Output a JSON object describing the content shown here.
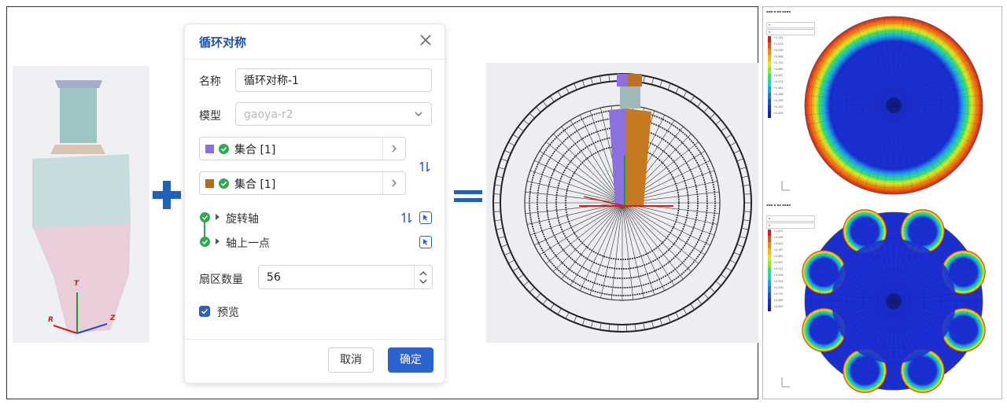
{
  "dialog": {
    "title": "循环对称",
    "name_label": "名称",
    "name_value": "循环对称-1",
    "model_label": "模型",
    "model_value": "gaoya-r2",
    "set1_label": "集合 [1]",
    "set1_color": "#8a6fe0",
    "set2_label": "集合 [1]",
    "set2_color": "#b56a1a",
    "axis_label": "旋转轴",
    "point_label": "轴上一点",
    "sectors_label": "扇区数量",
    "sectors_value": "56",
    "preview_label": "预览",
    "preview_checked": true,
    "cancel_label": "取消",
    "ok_label": "确定"
  },
  "model_axes": {
    "t": "T",
    "r": "R",
    "z": "Z"
  },
  "colors": {
    "accent": "#2a62d0",
    "operator": "#1f62b8",
    "ok_green": "#2fa84f"
  },
  "results": [
    {
      "pattern": "ring",
      "legend": [
        "+1.131",
        "+1.033",
        "+0.939",
        "+0.846",
        "+0.753",
        "+0.660",
        "+0.567",
        "+0.474",
        "+0.381",
        "+0.288",
        "+0.195",
        "+0.102",
        "+0.009"
      ]
    },
    {
      "pattern": "lobes",
      "legend": [
        "+1.022",
        "+0.939",
        "+0.853",
        "+0.767",
        "+0.682",
        "+0.597",
        "+0.511",
        "+0.426",
        "+0.341",
        "+0.256",
        "+0.170",
        "+0.085",
        "+0.000"
      ]
    }
  ]
}
